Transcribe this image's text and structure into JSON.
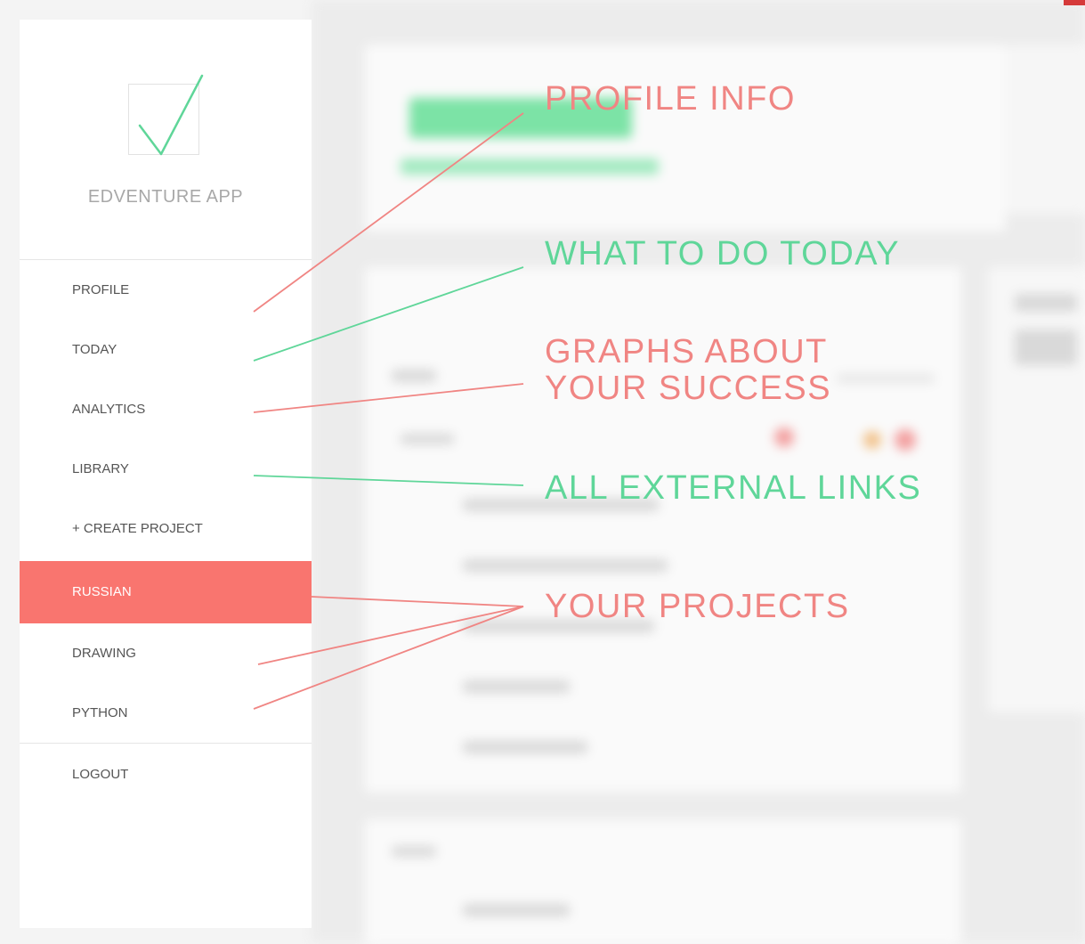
{
  "sidebar": {
    "app_name": "EDVENTURE APP",
    "logo_icon": "checkmark-icon",
    "items": [
      {
        "label": "PROFILE"
      },
      {
        "label": "TODAY"
      },
      {
        "label": "ANALYTICS"
      },
      {
        "label": "LIBRARY"
      },
      {
        "label": "+ CREATE PROJECT"
      },
      {
        "label": "RUSSIAN",
        "active": true
      },
      {
        "label": "DRAWING"
      },
      {
        "label": "PYTHON"
      }
    ],
    "logout_label": "LOGOUT"
  },
  "annotations": {
    "profile_info": "PROFILE INFO",
    "what_to_do_today": "WHAT TO DO TODAY",
    "graphs_line1": "GRAPHS ABOUT",
    "graphs_line2": "YOUR SUCCESS",
    "external_links": "ALL EXTERNAL LINKS",
    "your_projects": "YOUR PROJECTS"
  },
  "colors": {
    "accent_red": "#f9756f",
    "annotation_red": "#f08583",
    "annotation_green": "#5fd699"
  }
}
